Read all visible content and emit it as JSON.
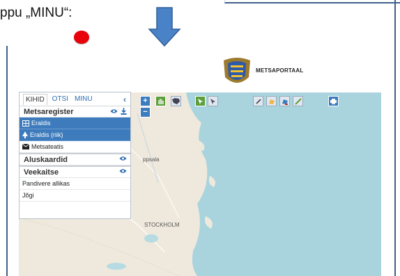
{
  "caption": {
    "text": "ppu „MINU“:"
  },
  "header": {
    "brand": "METSAPORTAAL"
  },
  "panel": {
    "tabs": [
      {
        "label": "KIHID",
        "active": true
      },
      {
        "label": "OTSI",
        "active": false
      },
      {
        "label": "MINU",
        "active": false
      }
    ],
    "groups": [
      {
        "title": "Metsaregister",
        "layers": [
          {
            "label": "Eraldis",
            "selected": true,
            "icon": "grid-icon"
          },
          {
            "label": "Eraldis (riik)",
            "selected": true,
            "icon": "tree-icon"
          },
          {
            "label": "Metsateatis",
            "selected": false,
            "icon": "envelope-icon"
          }
        ]
      },
      {
        "title": "Aluskaardid",
        "layers": []
      },
      {
        "title": "Veekaitse",
        "layers": [
          {
            "label": "Pandivere allikas",
            "selected": false
          },
          {
            "label": "Jõgi",
            "selected": false
          }
        ]
      }
    ]
  },
  "map": {
    "labels": {
      "city": "STOCKHOLM",
      "town": "ppsala"
    }
  },
  "colors": {
    "accent": "#3d7bbc",
    "marker": "#e8000b",
    "water": "#a9d4de",
    "tool_green": "#5c9e3a"
  }
}
